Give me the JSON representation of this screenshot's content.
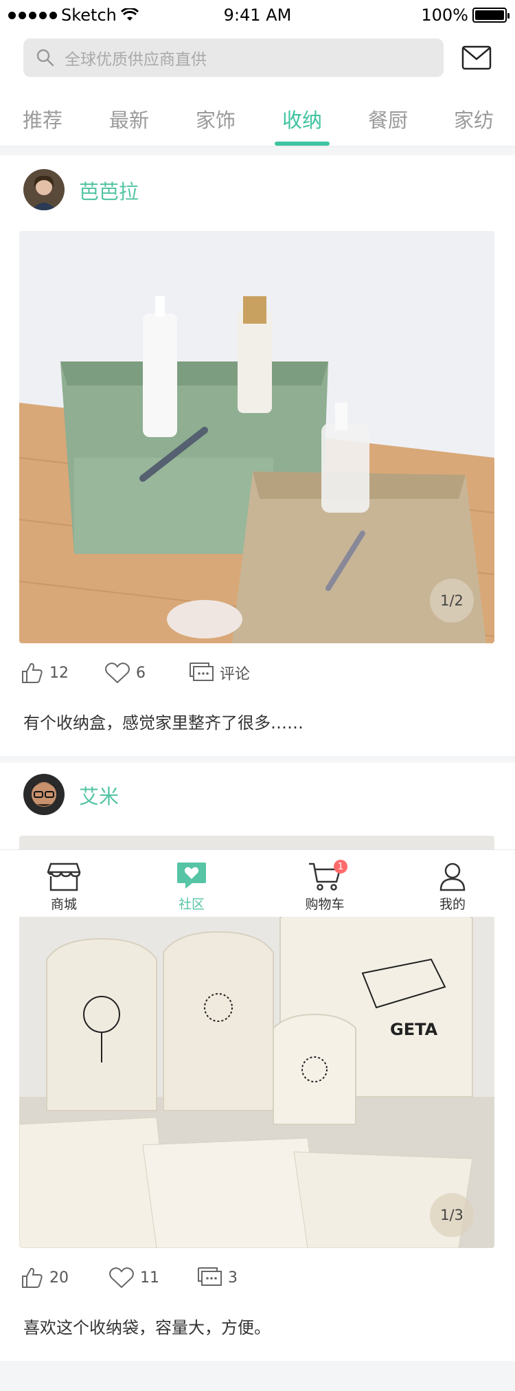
{
  "status_bar": {
    "carrier": "Sketch",
    "time": "9:41 AM",
    "battery": "100%"
  },
  "search": {
    "placeholder": "全球优质供应商直供"
  },
  "tabs": [
    {
      "label": "推荐",
      "active": false
    },
    {
      "label": "最新",
      "active": false
    },
    {
      "label": "家饰",
      "active": false
    },
    {
      "label": "收纳",
      "active": true
    },
    {
      "label": "餐厨",
      "active": false
    },
    {
      "label": "家纺",
      "active": false
    }
  ],
  "posts": [
    {
      "username": "芭芭拉",
      "page_indicator": "1/2",
      "likes": "12",
      "favorites": "6",
      "comments": "评论",
      "caption": "有个收纳盒，感觉家里整齐了很多……"
    },
    {
      "username": "艾米",
      "page_indicator": "1/3",
      "likes": "20",
      "favorites": "11",
      "comments": "3",
      "caption": "喜欢这个收纳袋，容量大，方便。"
    }
  ],
  "bottom_nav": [
    {
      "label": "商城",
      "icon": "store-icon",
      "active": false
    },
    {
      "label": "社区",
      "icon": "community-heart-icon",
      "active": true
    },
    {
      "label": "购物车",
      "icon": "cart-icon",
      "active": false,
      "badge": "1"
    },
    {
      "label": "我的",
      "icon": "profile-icon",
      "active": false
    }
  ],
  "colors": {
    "accent": "#3ec3a0",
    "username": "#56c4a5",
    "badge": "#ff6b6b"
  }
}
